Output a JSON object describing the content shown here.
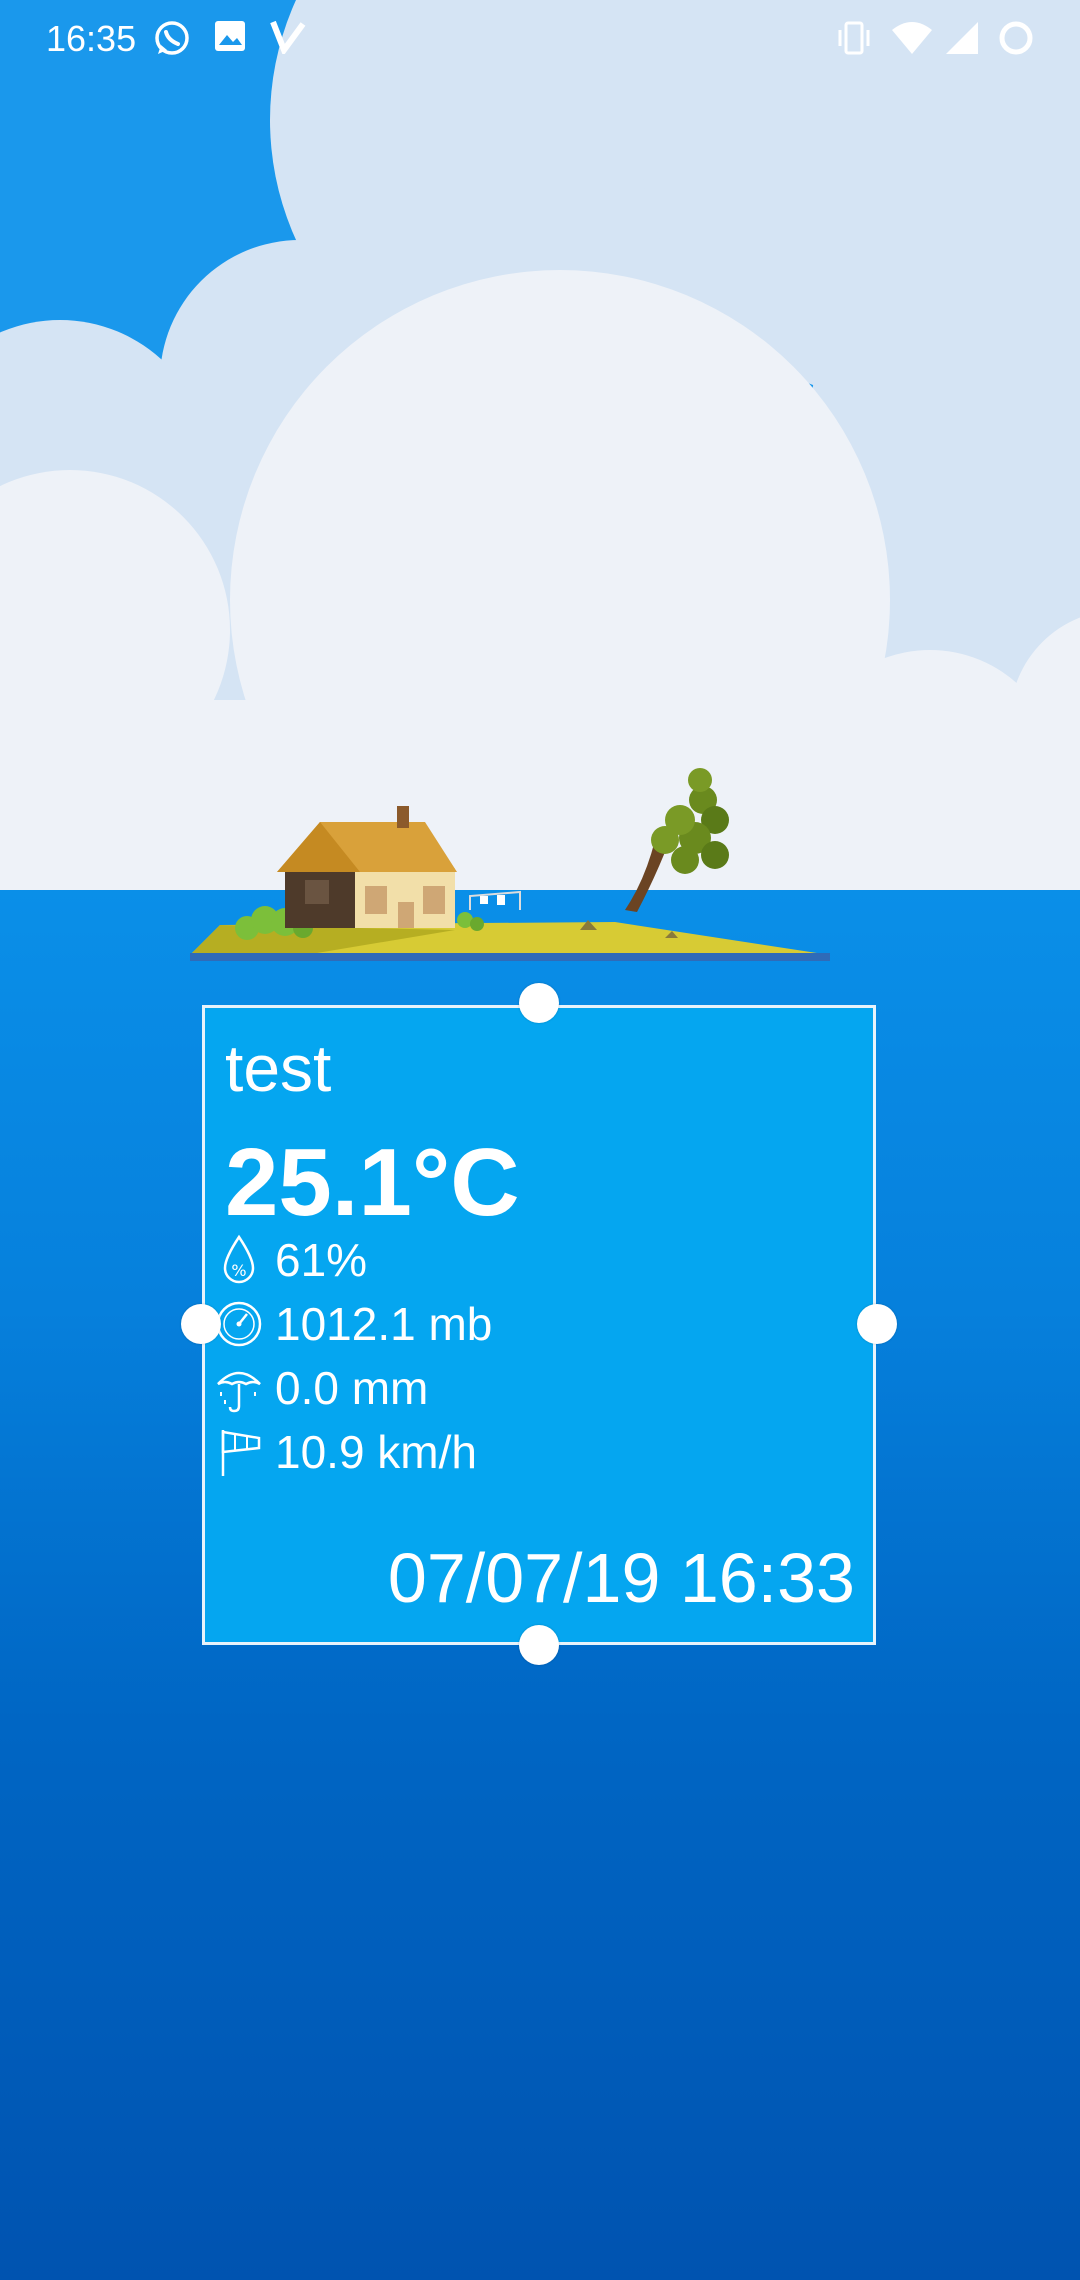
{
  "status_bar": {
    "time": "16:35",
    "left_icons": [
      "whatsapp-icon",
      "image-icon",
      "check-icon"
    ],
    "right_icons": [
      "vibrate-icon",
      "wifi-icon",
      "signal-icon",
      "battery-ring-icon"
    ]
  },
  "widget": {
    "location": "test",
    "temperature": "25.1°C",
    "humidity": "61%",
    "pressure": "1012.1 mb",
    "rain": "0.0 mm",
    "wind": "10.9 km/h",
    "updated": "07/07/19 16:33"
  },
  "colors": {
    "sky": "#1a98ec",
    "cloud_back": "#d5e4f4",
    "cloud_front": "#eef2f8",
    "sea_top": "#0a8fe8",
    "sea_bottom": "#0053b0",
    "widget_bg": "#05a6f0"
  }
}
